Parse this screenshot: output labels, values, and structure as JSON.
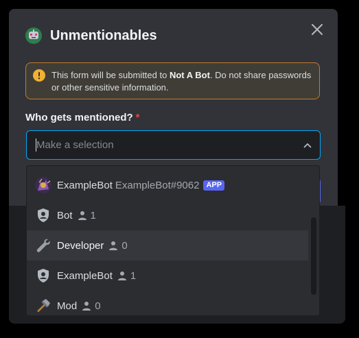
{
  "modal": {
    "title": "Unmentionables",
    "app_icon": "robot-icon",
    "close_icon": "close-icon"
  },
  "notice": {
    "icon": "warning-icon",
    "text_before": "This form will be submitted to ",
    "bot_name": "Not A Bot",
    "text_after": ". Do not share passwords or other sensitive information."
  },
  "field": {
    "label": "Who gets mentioned?",
    "required_mark": "*",
    "placeholder": "Make a selection",
    "chevron_icon": "chevron-up-icon"
  },
  "options": [
    {
      "name": "ExampleBot",
      "sub": "ExampleBot#9062",
      "tag": "APP",
      "icon": "avatar-icon"
    },
    {
      "name": "Bot",
      "count": "1",
      "icon": "role-shield-icon"
    },
    {
      "name": "Developer",
      "count": "0",
      "icon": "wrench-icon"
    },
    {
      "name": "ExampleBot",
      "count": "1",
      "icon": "role-shield-icon"
    },
    {
      "name": "Mod",
      "count": "0",
      "icon": "hammer-icon"
    }
  ],
  "colors": {
    "accent": "#5865f2",
    "warning_border": "#c27c2c",
    "focus_border": "#00a8fc",
    "required": "#f23f43"
  }
}
